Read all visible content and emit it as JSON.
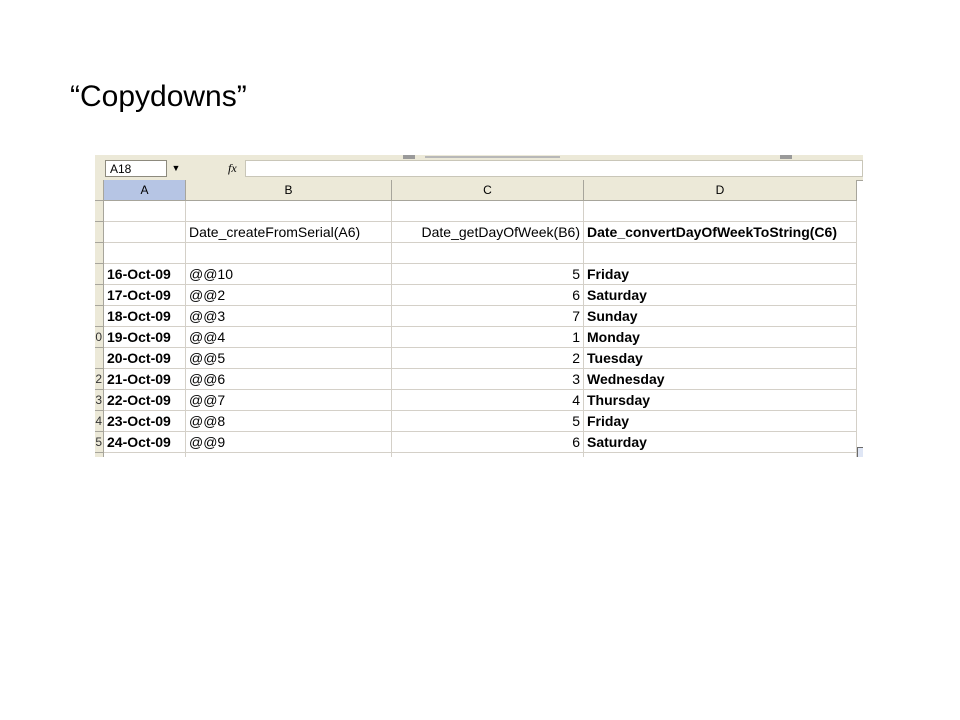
{
  "slide": {
    "title": "“Copydowns”"
  },
  "formula_bar": {
    "name_box": "A18",
    "fx_label": "fx",
    "formula": ""
  },
  "columns": [
    "A",
    "B",
    "C",
    "D"
  ],
  "rows": [
    {
      "num": "",
      "a": "",
      "b": "",
      "c": "",
      "d": ""
    },
    {
      "num": "",
      "a": "",
      "b": "Date_createFromSerial(A6)",
      "c": "Date_getDayOfWeek(B6)",
      "d": "Date_convertDayOfWeekToString(C6)"
    },
    {
      "num": "",
      "a": "",
      "b": "",
      "c": "",
      "d": ""
    },
    {
      "num": "",
      "a": "16-Oct-09",
      "b": "@@10",
      "c": "5",
      "d": "Friday"
    },
    {
      "num": "",
      "a": "17-Oct-09",
      "b": "@@2",
      "c": "6",
      "d": "Saturday"
    },
    {
      "num": "",
      "a": "18-Oct-09",
      "b": "@@3",
      "c": "7",
      "d": "Sunday"
    },
    {
      "num": "0",
      "a": "19-Oct-09",
      "b": "@@4",
      "c": "1",
      "d": "Monday"
    },
    {
      "num": "",
      "a": "20-Oct-09",
      "b": "@@5",
      "c": "2",
      "d": "Tuesday"
    },
    {
      "num": "2",
      "a": "21-Oct-09",
      "b": "@@6",
      "c": "3",
      "d": "Wednesday"
    },
    {
      "num": "3",
      "a": "22-Oct-09",
      "b": "@@7",
      "c": "4",
      "d": "Thursday"
    },
    {
      "num": "4",
      "a": "23-Oct-09",
      "b": "@@8",
      "c": "5",
      "d": "Friday"
    },
    {
      "num": "5",
      "a": "24-Oct-09",
      "b": "@@9",
      "c": "6",
      "d": "Saturday"
    },
    {
      "num": "",
      "a": "",
      "b": "",
      "c": "",
      "d": ""
    }
  ]
}
